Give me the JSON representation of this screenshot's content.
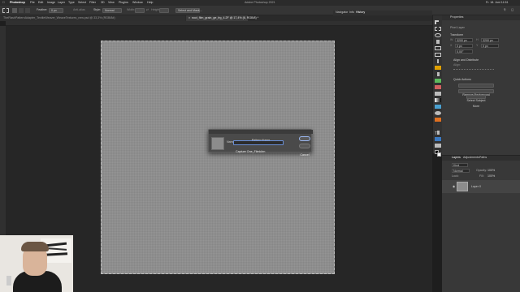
{
  "menubar": {
    "items": [
      "Photoshop",
      "File",
      "Edit",
      "Image",
      "Layer",
      "Type",
      "Select",
      "Filter",
      "3D",
      "View",
      "Plugins",
      "Window",
      "Help"
    ],
    "window_title": "Adobe Photoshop 2021",
    "clock": "Fr. 18. Juni 11:51"
  },
  "options_bar": {
    "feather_label": "Feather:",
    "feather_value": "0 px",
    "antialias_label": "Anti-alias",
    "style_label": "Style:",
    "style_value": "Normal",
    "width_label": "Width:",
    "height_label": "Height:",
    "select_mask_button": "Select and Mask..."
  },
  "tabs": {
    "doc1": "TheFlashPatternAdapter_TextileWeaver_WeaveTextures_new.psd @ 33,3% (RGB/8#)",
    "doc2": "noct_film_grain_ge_frg_4.2F @ 17,4% (6, RGB/8) *"
  },
  "top_right_panels": {
    "tabs": [
      "Navigator",
      "Info",
      "History"
    ]
  },
  "dialog": {
    "title": "Pattern Name",
    "name_label": "Name:",
    "name_value": "Capture One_Filmkörn",
    "ok_label": "OK",
    "cancel_label": "Cancel"
  },
  "properties": {
    "title": "Properties",
    "section": "Pixel Layer",
    "transform_label": "Transform",
    "w_value": "3200 px",
    "h_value": "3200 px",
    "x_value": "0 px",
    "y_value": "0 px",
    "angle_value": "0,00°",
    "align_label": "Align and Distribute",
    "align_sub": "Align:",
    "quick_actions_label": "Quick Actions",
    "remove_bg_button": "Remove Background",
    "select_subject_button": "Select Subject",
    "more_button": "More"
  },
  "layers": {
    "tabs": [
      "Layers",
      "Adjustments",
      "Paths"
    ],
    "kind_label": "Kind",
    "blend_mode": "Normal",
    "opacity_label": "Opacity:",
    "opacity_value": "100%",
    "lock_label": "Lock:",
    "fill_label": "Fill:",
    "fill_value": "100%",
    "layer_name": "Layer 0"
  },
  "colors": {
    "canvas": "#8e8e8e",
    "accent": "#6a8fd6",
    "panel": "#383838"
  }
}
